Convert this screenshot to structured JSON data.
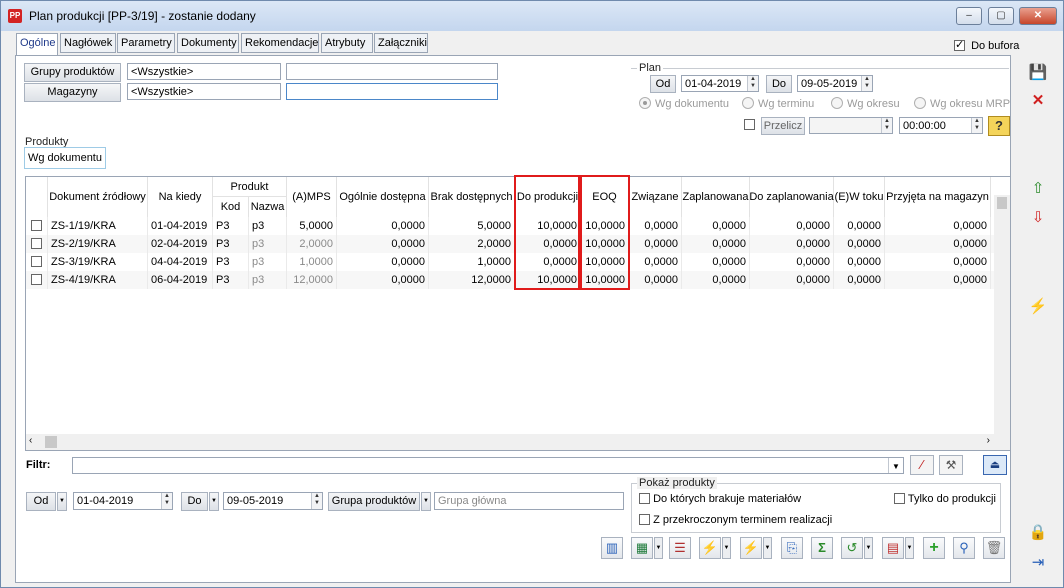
{
  "window": {
    "title": "Plan produkcji [PP-3/19] - zostanie dodany",
    "app_icon": "PP",
    "controls": {
      "minimize": "‒",
      "maximize": "▢",
      "close": "✕"
    }
  },
  "tabs": [
    "Ogólne",
    "Nagłówek",
    "Parametry",
    "Dokumenty",
    "Rekomendacje",
    "Atrybuty",
    "Załączniki"
  ],
  "do_bufora": {
    "label": "Do bufora",
    "checked": true
  },
  "filters": {
    "grupy_label": "Grupy produktów",
    "grupy_value": "<Wszystkie>",
    "grupy_extra": "",
    "magazyny_label": "Magazyny",
    "magazyny_value": "<Wszystkie>",
    "magazyny_extra": ""
  },
  "plan": {
    "label": "Plan",
    "od_label": "Od",
    "od_value": "01-04-2019",
    "do_label": "Do",
    "do_value": "09-05-2019",
    "radios": [
      "Wg dokumentu",
      "Wg terminu",
      "Wg okresu",
      "Wg okresu MRP"
    ],
    "przelicz_label": "Przelicz",
    "przelicz_value": "",
    "time_value": "00:00:00"
  },
  "produkty": {
    "label": "Produkty",
    "subtab": "Wg dokumentu"
  },
  "grid": {
    "group_header": "Produkt",
    "columns": [
      "Dokument źródłowy",
      "Na kiedy",
      "Kod",
      "Nazwa",
      "(A)MPS",
      "Ogólnie dostępna",
      "Brak dostępnych",
      "Do produkcji",
      "EOQ",
      "Związane",
      "Zaplanowana",
      "Do zaplanowania",
      "(E)W toku",
      "Przyjęta na magazyn"
    ],
    "rows": [
      [
        "ZS-1/19/KRA",
        "01-04-2019",
        "P3",
        "p3",
        "5,0000",
        "0,0000",
        "5,0000",
        "10,0000",
        "10,0000",
        "0,0000",
        "0,0000",
        "0,0000",
        "0,0000",
        "0,0000"
      ],
      [
        "ZS-2/19/KRA",
        "02-04-2019",
        "P3",
        "p3",
        "2,0000",
        "0,0000",
        "2,0000",
        "0,0000",
        "10,0000",
        "0,0000",
        "0,0000",
        "0,0000",
        "0,0000",
        "0,0000"
      ],
      [
        "ZS-3/19/KRA",
        "04-04-2019",
        "P3",
        "p3",
        "1,0000",
        "0,0000",
        "1,0000",
        "0,0000",
        "10,0000",
        "0,0000",
        "0,0000",
        "0,0000",
        "0,0000",
        "0,0000"
      ],
      [
        "ZS-4/19/KRA",
        "06-04-2019",
        "P3",
        "p3",
        "12,0000",
        "0,0000",
        "12,0000",
        "10,0000",
        "10,0000",
        "0,0000",
        "0,0000",
        "0,0000",
        "0,0000",
        "0,0000"
      ]
    ],
    "highlight_color": "#e01b1b"
  },
  "filtr": {
    "label": "Filtr:",
    "value": ""
  },
  "bottom": {
    "od_label": "Od",
    "od_value": "01-04-2019",
    "do_label": "Do",
    "do_value": "09-05-2019",
    "grupa_label": "Grupa produktów",
    "grupa_value": "Grupa główna",
    "pokaz_label": "Pokaż produkty",
    "chk_brakuje": "Do których brakuje materiałów",
    "chk_tylko": "Tylko do produkcji",
    "chk_przekroczonym": "Z przekroczonym terminem realizacji"
  }
}
